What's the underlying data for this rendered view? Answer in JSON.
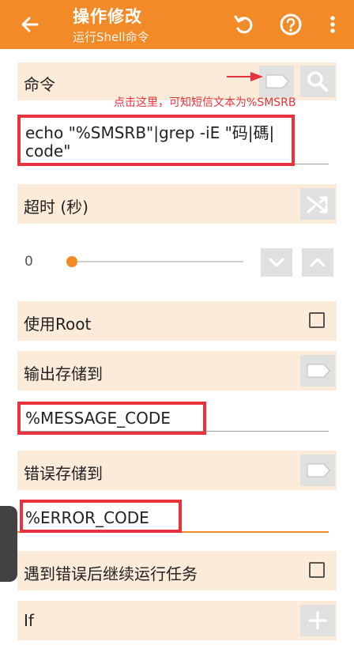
{
  "appbar": {
    "title": "操作修改",
    "subtitle": "运行Shell命令",
    "back_icon": "arrow-left-icon",
    "reset_icon": "undo-icon",
    "help_icon": "help-circle-icon",
    "menu_icon": "more-vert-icon"
  },
  "command": {
    "label": "命令",
    "value_line1": "echo \"%SMSRB\"|grep -iE \"码|碼|",
    "value_line2": "code\""
  },
  "annotation": {
    "text": "点击这里，可知短信文本为%SMSRB"
  },
  "timeout": {
    "label": "超时 (秒)",
    "value": "0"
  },
  "use_root": {
    "label": "使用Root",
    "checked": false
  },
  "output_store": {
    "label": "输出存储到",
    "value": "%MESSAGE_CODE"
  },
  "error_store": {
    "label": "错误存储到",
    "value": "%ERROR_CODE"
  },
  "continue_on_error": {
    "label": "遇到错误后继续运行任务",
    "checked": false
  },
  "if_row": {
    "label": "If"
  },
  "colors": {
    "accent": "#f18a27",
    "row_bg": "#fdebd9",
    "highlight": "#e8323c"
  }
}
